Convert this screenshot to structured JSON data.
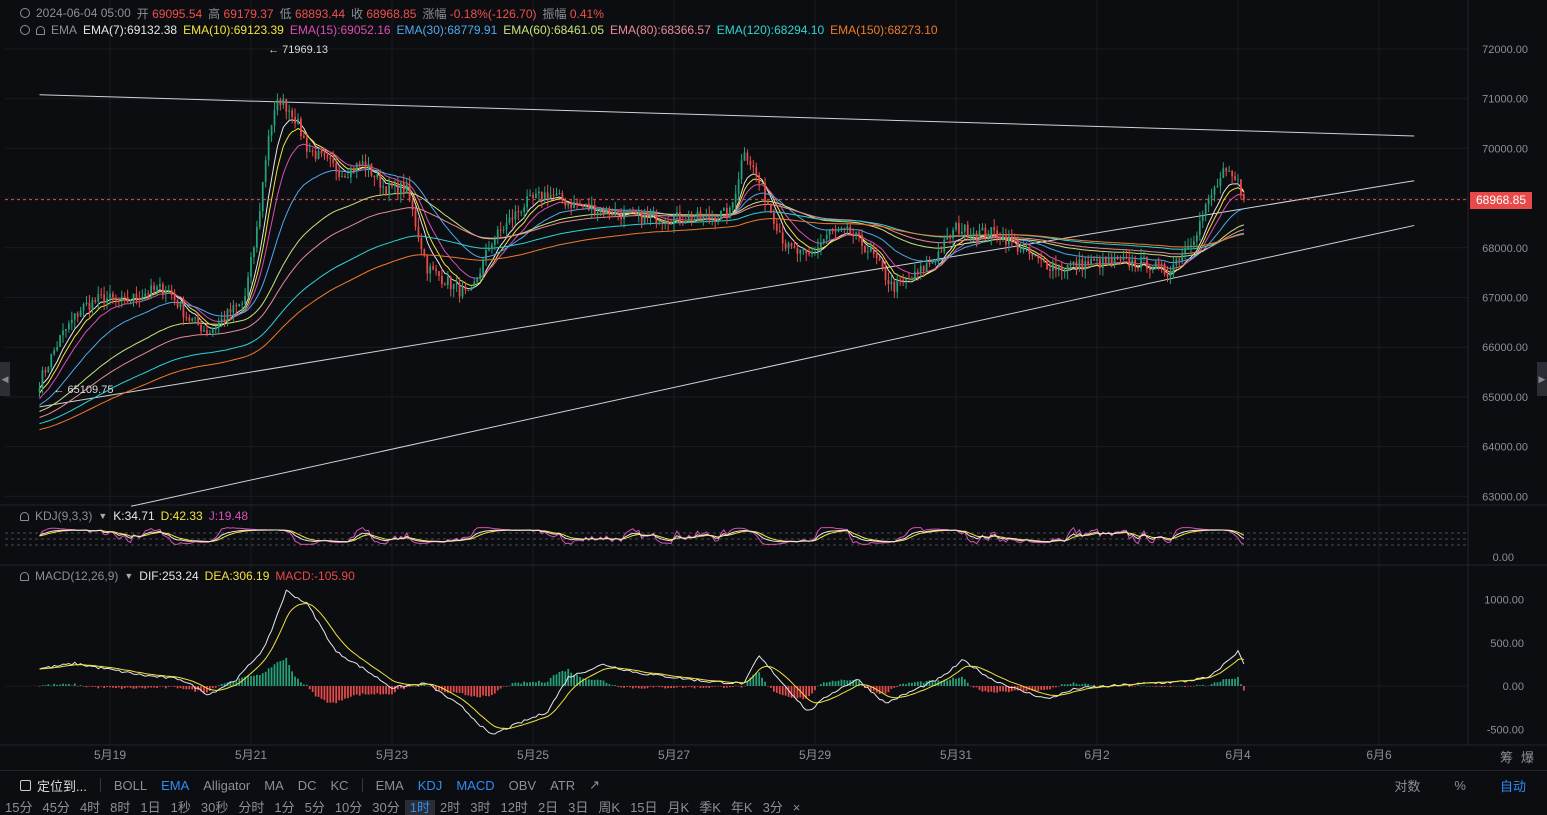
{
  "header": {
    "date": "2024-06-04 05:00",
    "open_label": "开",
    "open": "69095.54",
    "high_label": "高",
    "high": "69179.37",
    "low_label": "低",
    "low": "68893.44",
    "close_label": "收",
    "close": "68968.85",
    "change_label": "涨幅",
    "change": "-0.18%(-126.70)",
    "amp_label": "振幅",
    "amp": "0.41%"
  },
  "ema_legend": {
    "name": "EMA",
    "items": [
      {
        "text": "EMA(7):69132.38",
        "color": "#e6e6e6"
      },
      {
        "text": "EMA(10):69123.39",
        "color": "#f2e33b"
      },
      {
        "text": "EMA(15):69052.16",
        "color": "#d84fb5"
      },
      {
        "text": "EMA(30):68779.91",
        "color": "#4fa8f0"
      },
      {
        "text": "EMA(60):68461.05",
        "color": "#c8e27a"
      },
      {
        "text": "EMA(80):68366.57",
        "color": "#e88a9a"
      },
      {
        "text": "EMA(120):68294.10",
        "color": "#2fd4d4"
      },
      {
        "text": "EMA(150):68273.10",
        "color": "#f07a2a"
      }
    ]
  },
  "kdj_legend": {
    "name": "KDJ(9,3,3)",
    "k": "K:34.71",
    "d": "D:42.33",
    "j": "J:19.48"
  },
  "macd_legend": {
    "name": "MACD(12,26,9)",
    "dif": "DIF:253.24",
    "dea": "DEA:306.19",
    "macd": "MACD:-105.90"
  },
  "last_price_tag": "68968.85",
  "annotations": {
    "high_mark": "← 71969.13",
    "low_mark": "← 65109.75"
  },
  "corner": {
    "a": "筹",
    "b": "爆"
  },
  "toolbar": {
    "locate": "定位到...",
    "main_indicators": [
      "BOLL",
      "EMA",
      "Alligator",
      "MA",
      "DC",
      "KC"
    ],
    "active_main": "EMA",
    "sub_indicators": [
      "EMA",
      "KDJ",
      "MACD",
      "OBV",
      "ATR"
    ],
    "active_sub": [
      "KDJ",
      "MACD"
    ],
    "right": [
      "对数",
      "%",
      "自动"
    ],
    "active_right": "自动"
  },
  "timeframes": {
    "items": [
      "15分",
      "45分",
      "4时",
      "8时",
      "1日",
      "1秒",
      "30秒",
      "分时",
      "1分",
      "5分",
      "10分",
      "30分",
      "1时",
      "2时",
      "3时",
      "12时",
      "2日",
      "3日",
      "周K",
      "15日",
      "月K",
      "季K",
      "年K",
      "3分",
      "×"
    ],
    "active": "1时"
  },
  "colors": {
    "up": "#26a17b",
    "down": "#e84a4a",
    "background": "#0c0d10",
    "dif": "#e6e6e6",
    "dea": "#f2e33b",
    "k": "#e6e6e6",
    "d": "#f2e33b",
    "j": "#d84fb5"
  },
  "chart_data": [
    {
      "type": "candlestick",
      "title": "",
      "x_ticks": [
        "5月19",
        "5月21",
        "5月23",
        "5月25",
        "5月27",
        "5月29",
        "5月31",
        "6月2",
        "6月4",
        "6月6"
      ],
      "y_ticks": [
        "72000.00",
        "71000.00",
        "70000.00",
        "69000.00",
        "68000.00",
        "67000.00",
        "66000.00",
        "65000.00",
        "64000.00",
        "63000.00"
      ],
      "ylim": [
        62800,
        72750
      ],
      "closes_guide": {
        "days": [
          18.0,
          18.3,
          18.6,
          18.9,
          19.2,
          19.5,
          19.8,
          20.1,
          20.4,
          20.7,
          20.9,
          21.1,
          21.25,
          21.4,
          21.6,
          21.8,
          22.0,
          22.3,
          22.6,
          22.9,
          23.2,
          23.5,
          23.8,
          24.1,
          24.4,
          24.7,
          24.9,
          25.2,
          25.5,
          25.8,
          26.2,
          26.6,
          27.0,
          27.4,
          27.8,
          28.0,
          28.3,
          28.6,
          28.9,
          29.2,
          29.5,
          29.8,
          30.1,
          30.4,
          30.7,
          31.0,
          31.3,
          31.6,
          31.9,
          32.2,
          32.5,
          32.9,
          33.3,
          33.7,
          34.0,
          34.2,
          34.4,
          34.6,
          34.8,
          35.0,
          35.1
        ],
        "closes": [
          65300,
          66200,
          66800,
          67000,
          66900,
          67100,
          67200,
          66600,
          66300,
          66700,
          66900,
          68500,
          70300,
          71000,
          70700,
          70000,
          69800,
          69500,
          69700,
          69200,
          69200,
          67600,
          67300,
          67000,
          68100,
          68600,
          68900,
          69100,
          68900,
          68800,
          68700,
          68600,
          68600,
          68600,
          68700,
          70000,
          69000,
          68000,
          67800,
          68300,
          68300,
          67900,
          67200,
          67400,
          67800,
          68400,
          68300,
          68300,
          68000,
          67700,
          67600,
          67700,
          67700,
          67700,
          67500,
          67900,
          68300,
          69000,
          69500,
          69300,
          68970
        ]
      },
      "high_annotation": {
        "day": 21.2,
        "value": 71969.13
      },
      "low_annotation": {
        "day": 18.0,
        "value": 65109.75
      },
      "last_price": 68968.85,
      "ema_final": {
        "EMA(7)": 69132.38,
        "EMA(10)": 69123.39,
        "EMA(15)": 69052.16,
        "EMA(30)": 68779.91,
        "EMA(60)": 68461.05,
        "EMA(80)": 68366.57,
        "EMA(120)": 68294.1,
        "EMA(150)": 68273.1
      },
      "trendlines": [
        {
          "from": {
            "day": 18.0,
            "value": 71080
          },
          "to": {
            "day": 37.5,
            "value": 70250
          }
        },
        {
          "from": {
            "day": 18.0,
            "value": 64800
          },
          "to": {
            "day": 37.5,
            "value": 69350
          }
        },
        {
          "from": {
            "day": 19.3,
            "value": 62800
          },
          "to": {
            "day": 37.5,
            "value": 68450
          }
        }
      ]
    },
    {
      "type": "line",
      "title": "KDJ(9,3,3)",
      "y_ticks": [
        "0.00"
      ],
      "ylim": [
        0,
        100
      ],
      "series": [
        {
          "name": "K",
          "final": 34.71
        },
        {
          "name": "D",
          "final": 42.33
        },
        {
          "name": "J",
          "final": 19.48
        }
      ]
    },
    {
      "type": "bar",
      "title": "MACD(12,26,9)",
      "y_ticks": [
        "1000.00",
        "500.00",
        "0.00",
        "-500.00"
      ],
      "ylim": [
        -600,
        1100
      ],
      "dif_guide": {
        "days": [
          18.0,
          18.5,
          19.0,
          19.5,
          20.0,
          20.4,
          20.8,
          21.2,
          21.5,
          21.8,
          22.2,
          22.6,
          23.0,
          23.5,
          24.0,
          24.4,
          24.8,
          25.2,
          25.5,
          26.0,
          26.5,
          27.0,
          27.5,
          28.0,
          28.2,
          28.6,
          28.9,
          29.2,
          29.6,
          30.0,
          30.4,
          30.8,
          31.1,
          31.5,
          31.9,
          32.3,
          32.7,
          33.2,
          33.7,
          34.2,
          34.6,
          35.0,
          35.1
        ],
        "values": [
          200,
          260,
          190,
          120,
          80,
          -100,
          80,
          450,
          1100,
          950,
          400,
          200,
          -20,
          30,
          -250,
          -570,
          -430,
          -300,
          100,
          250,
          150,
          100,
          50,
          30,
          350,
          -20,
          -300,
          -100,
          80,
          -200,
          -50,
          100,
          300,
          80,
          -50,
          -150,
          -30,
          0,
          30,
          50,
          100,
          400,
          253
        ],
        "dea_final": 306.19,
        "macd_final": -105.9
      }
    }
  ]
}
